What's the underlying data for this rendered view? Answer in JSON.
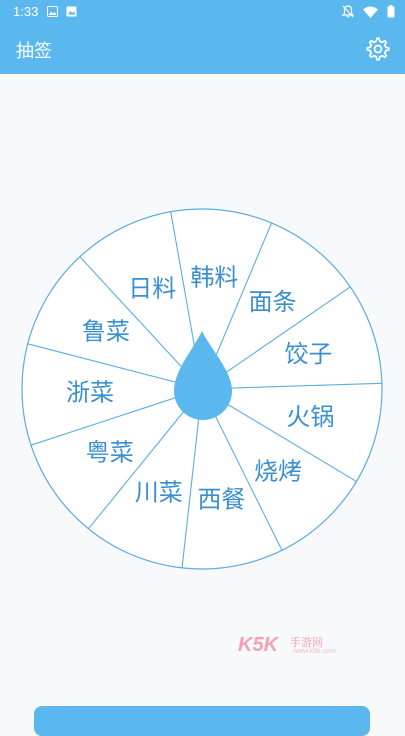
{
  "status_bar": {
    "time": "1:33",
    "left_icons": [
      "image-icon",
      "photo-icon"
    ],
    "right_icons": [
      "notification-off-icon",
      "wifi-icon",
      "battery-icon"
    ]
  },
  "app_bar": {
    "title": "抽签",
    "action_icon": "gear-icon"
  },
  "wheel": {
    "segments": [
      "韩料",
      "面条",
      "饺子",
      "火锅",
      "烧烤",
      "西餐",
      "川菜",
      "粤菜",
      "浙菜",
      "鲁菜",
      "日料"
    ],
    "pointer_icon": "droplet-pointer-icon"
  },
  "watermark": {
    "brand": "K5K",
    "text": "手游网",
    "url": "www.k5k.com"
  },
  "colors": {
    "primary": "#5bb8ee",
    "wheel_line": "#5aaee0",
    "text": "#3a8fcf",
    "background": "#f8f9fb"
  }
}
